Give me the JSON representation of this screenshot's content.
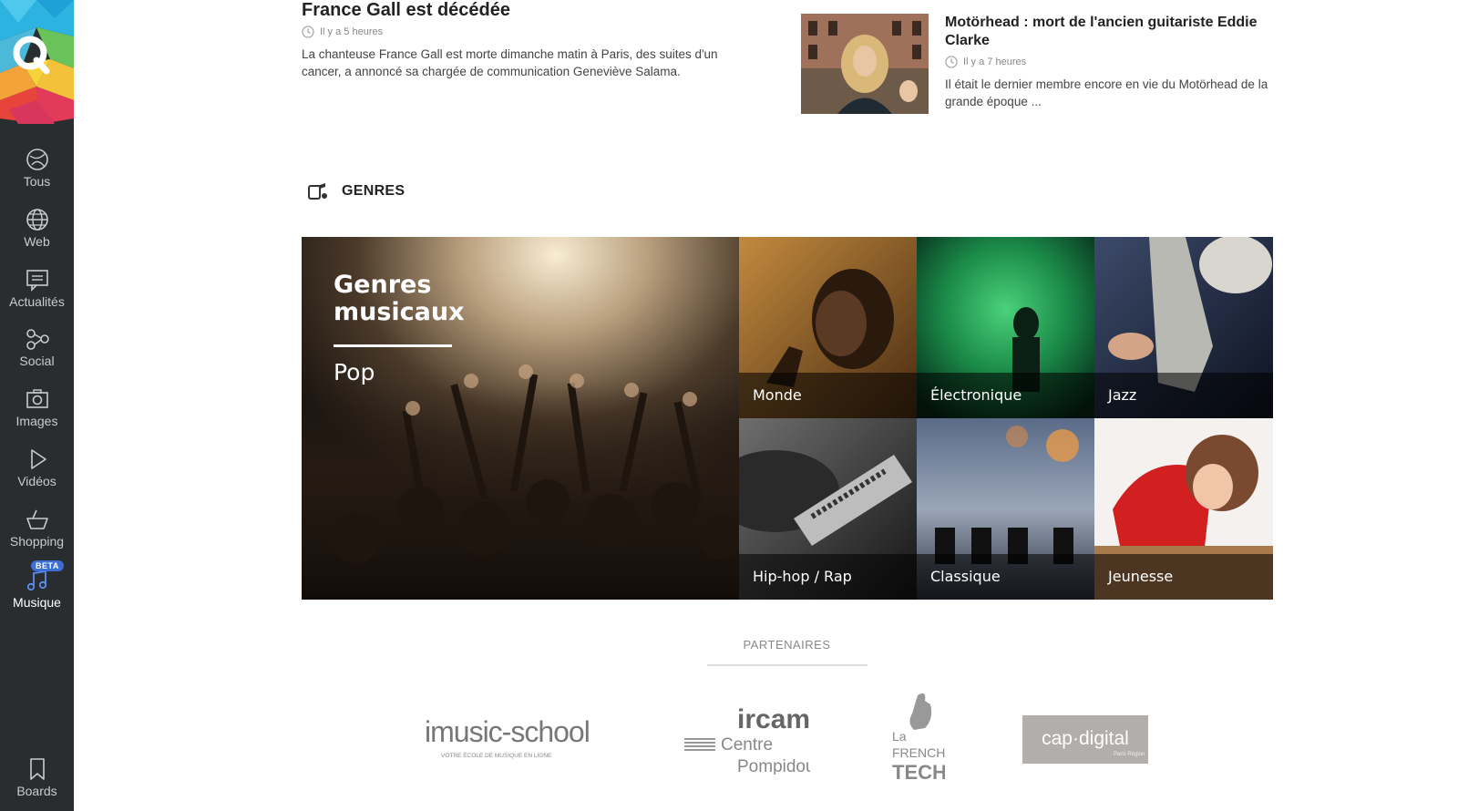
{
  "sidebar": {
    "items": [
      {
        "label": "Tous",
        "icon": "tous-icon"
      },
      {
        "label": "Web",
        "icon": "globe-icon"
      },
      {
        "label": "Actualités",
        "icon": "news-icon"
      },
      {
        "label": "Social",
        "icon": "social-icon"
      },
      {
        "label": "Images",
        "icon": "camera-icon"
      },
      {
        "label": "Vidéos",
        "icon": "play-icon"
      },
      {
        "label": "Shopping",
        "icon": "basket-icon"
      },
      {
        "label": "Musique",
        "icon": "music-note-icon",
        "badge": "BETA",
        "active": true
      }
    ],
    "boards": {
      "label": "Boards",
      "icon": "bookmark-icon"
    }
  },
  "news": {
    "left": {
      "title": "France Gall est décédée",
      "time": "Il y a 5 heures",
      "desc": "La chanteuse France Gall est morte dimanche matin à Paris, des suites d'un cancer, a annoncé sa chargée de communication Geneviève Salama."
    },
    "right": {
      "title": "Motörhead : mort de l'ancien guitariste Eddie Clarke",
      "time": "Il y a 7 heures",
      "desc": "Il était le dernier membre encore en vie du Motörhead de la grande époque ..."
    }
  },
  "genres": {
    "heading": "GENRES",
    "feature": {
      "title": "Genres musicaux",
      "subtitle": "Pop"
    },
    "tiles": [
      "Monde",
      "Électronique",
      "Jazz",
      "Hip-hop / Rap",
      "Classique",
      "Jeunesse"
    ]
  },
  "partners": {
    "title": "PARTENAIRES",
    "logos": {
      "imusic": {
        "main": "imusic-school",
        "sub": "VOTRE ÉCOLE DE MUSIQUE EN LIGNE"
      },
      "ircam": {
        "main": "ircam",
        "line1": "Centre",
        "line2": "Pompidou"
      },
      "frenchtech": {
        "line1": "La",
        "line2": "FRENCH",
        "line3": "TECH"
      },
      "capdigital": {
        "main": "cap·digital",
        "sub": "Paris Région"
      }
    }
  },
  "colors": {
    "sidebar": "#2a2d30",
    "accent": "#3b6fd1"
  }
}
